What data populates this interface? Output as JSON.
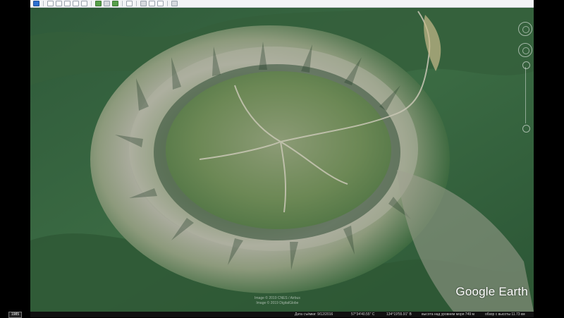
{
  "app": {
    "name": "Google Earth",
    "logo_text": "Google Earth"
  },
  "toolbar": {
    "buttons": [
      {
        "name": "sidebar-toggle",
        "icon": "sidebar-icon"
      },
      {
        "name": "add-placemark",
        "icon": "placemark-icon"
      },
      {
        "name": "add-polygon",
        "icon": "polygon-icon"
      },
      {
        "name": "add-path",
        "icon": "path-icon"
      },
      {
        "name": "add-image-overlay",
        "icon": "image-overlay-icon"
      },
      {
        "name": "record-tour",
        "icon": "record-tour-icon"
      },
      {
        "name": "historical-imagery",
        "icon": "clock-icon"
      },
      {
        "name": "sunlight",
        "icon": "sun-icon"
      },
      {
        "name": "switch-to-sky",
        "icon": "planet-icon"
      },
      {
        "name": "ruler",
        "icon": "ruler-icon"
      },
      {
        "name": "email",
        "icon": "email-icon"
      },
      {
        "name": "print",
        "icon": "print-icon"
      },
      {
        "name": "save-image",
        "icon": "save-image-icon"
      },
      {
        "name": "view-in-maps",
        "icon": "maps-icon"
      }
    ]
  },
  "status_bar": {
    "scale_label": "1985",
    "imagery_date": "Дата съёмки: 9/12/2016",
    "latitude": "57°34'40.55\" С",
    "longitude": "134°19'55.91\" В",
    "elevation": "высота над уровнем моря   749 м",
    "eye_altitude": "обзор с высоты   11.73 км"
  },
  "watermark": {
    "line1": "Image © 2019 CNES / Airbus",
    "line2": "Image © 2019 DigitalGlobe"
  },
  "colors": {
    "terrain_dark": "#2f5a3a",
    "terrain_green": "#4d7a45",
    "rock_gray": "#a9ab9c",
    "status_bg": "#111111"
  }
}
